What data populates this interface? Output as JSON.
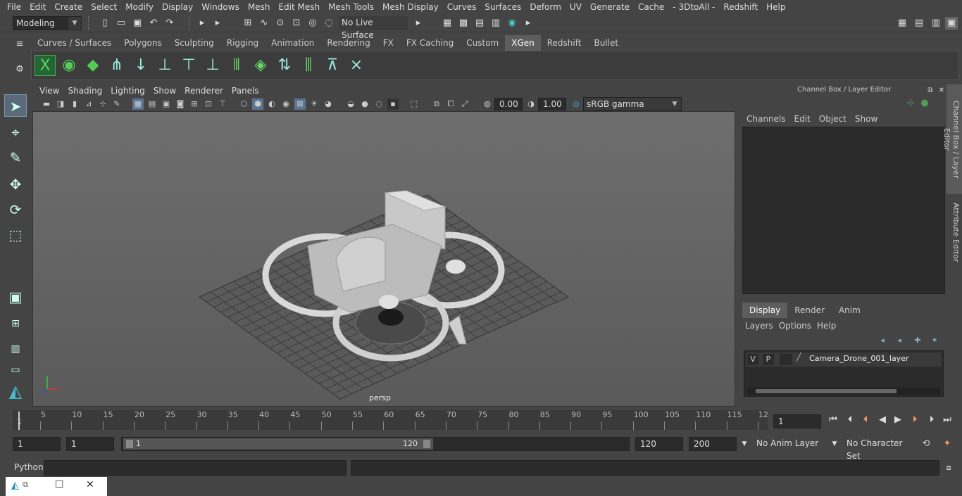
{
  "menu": [
    "File",
    "Edit",
    "Create",
    "Select",
    "Modify",
    "Display",
    "Windows",
    "Mesh",
    "Edit Mesh",
    "Mesh Tools",
    "Mesh Display",
    "Curves",
    "Surfaces",
    "Deform",
    "UV",
    "Generate",
    "Cache",
    "- 3DtoAll -",
    "Redshift",
    "Help"
  ],
  "mode_selector": "Modeling",
  "live_surface": "No Live Surface",
  "shelf_tabs": [
    "Curves / Surfaces",
    "Polygons",
    "Sculpting",
    "Rigging",
    "Animation",
    "Rendering",
    "FX",
    "FX Caching",
    "Custom",
    "XGen",
    "Redshift",
    "Bullet"
  ],
  "active_shelf_tab": "XGen",
  "viewport_menu": [
    "View",
    "Shading",
    "Lighting",
    "Show",
    "Renderer",
    "Panels"
  ],
  "exposure": "0.00",
  "gamma": "1.00",
  "color_space": "sRGB gamma",
  "camera_label": "persp",
  "channel_box": {
    "title": "Channel Box / Layer Editor",
    "menu": [
      "Channels",
      "Edit",
      "Object",
      "Show"
    ]
  },
  "layer_tabs": [
    "Display",
    "Render",
    "Anim"
  ],
  "active_layer_tab": "Display",
  "layer_menu": [
    "Layers",
    "Options",
    "Help"
  ],
  "layer": {
    "v": "V",
    "p": "P",
    "name": "Camera_Drone_001_layer"
  },
  "side_tabs": [
    "Channel Box / Layer Editor",
    "Attribute Editor"
  ],
  "timeline_ticks": [
    "5",
    "10",
    "15",
    "20",
    "25",
    "30",
    "35",
    "40",
    "45",
    "50",
    "55",
    "60",
    "65",
    "70",
    "75",
    "80",
    "85",
    "90",
    "95",
    "100",
    "105",
    "110",
    "115",
    "12"
  ],
  "timeline_start": "1",
  "current_frame": "1",
  "range": {
    "start": "1",
    "start2": "1",
    "slider_start": "1",
    "slider_end": "120",
    "end": "120",
    "max": "200"
  },
  "anim_layer": "No Anim Layer",
  "character_set": "No Character Set",
  "script_lang": "Python"
}
